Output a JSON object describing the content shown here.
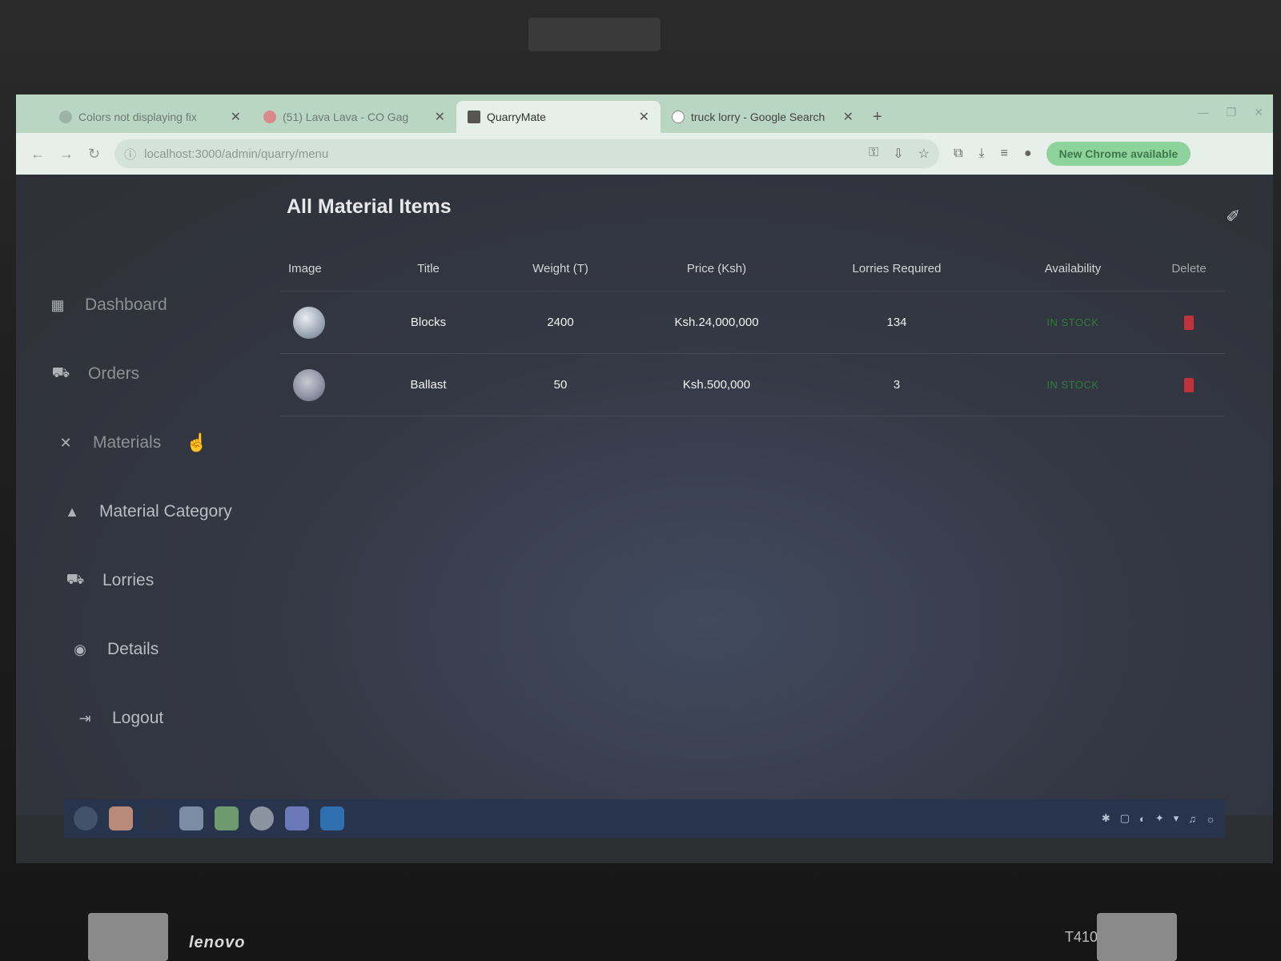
{
  "laptop": {
    "brand": "lenovo",
    "model": "T410"
  },
  "browser": {
    "tabs": [
      {
        "label": "Colors not displaying fix",
        "active": false
      },
      {
        "label": "(51) Lava Lava - CO Gag",
        "active": false
      },
      {
        "label": "QuarryMate",
        "active": true
      },
      {
        "label": "truck lorry - Google Search",
        "active": false
      }
    ],
    "new_tab": "+",
    "url": "localhost:3000/admin/quarry/menu",
    "update_button": "New Chrome available"
  },
  "sidebar": {
    "items": [
      {
        "label": "Dashboard",
        "icon": "dashboard-icon"
      },
      {
        "label": "Orders",
        "icon": "truck-icon"
      },
      {
        "label": "Materials",
        "icon": "tools-icon"
      },
      {
        "label": "Material Category",
        "icon": "shapes-icon"
      },
      {
        "label": "Lorries",
        "icon": "lorry-icon"
      },
      {
        "label": "Details",
        "icon": "details-icon"
      },
      {
        "label": "Logout",
        "icon": "logout-icon"
      }
    ]
  },
  "main": {
    "title": "All Material Items",
    "columns": [
      "Image",
      "Title",
      "Weight (T)",
      "Price (Ksh)",
      "Lorries Required",
      "Availability",
      "Delete"
    ],
    "rows": [
      {
        "title": "Blocks",
        "weight": "2400",
        "price": "Ksh.24,000,000",
        "lorries": "134",
        "availability": "IN STOCK"
      },
      {
        "title": "Ballast",
        "weight": "50",
        "price": "Ksh.500,000",
        "lorries": "3",
        "availability": "IN STOCK"
      }
    ]
  },
  "colors": {
    "accent_green": "#2f7d3c",
    "delete_red": "#c1323a",
    "background": "#2e3036"
  }
}
